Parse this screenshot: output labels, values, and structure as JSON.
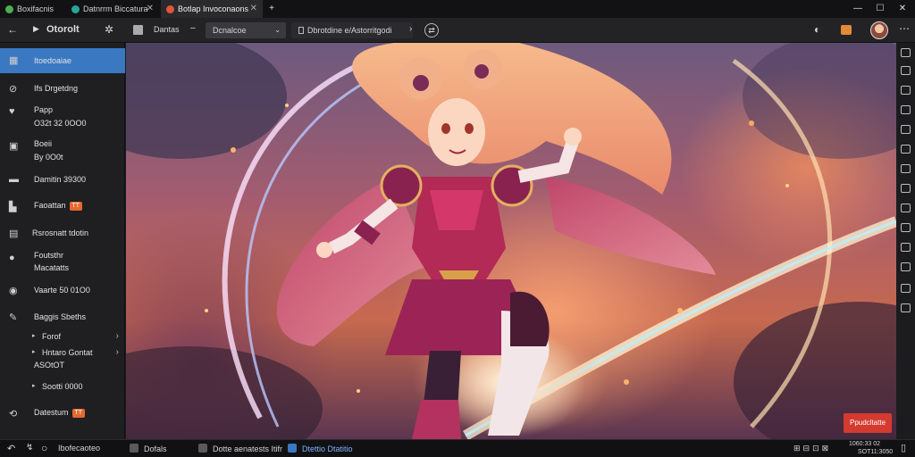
{
  "tabs": [
    {
      "label": "Boxifacnis",
      "color": "#4caf50",
      "active": false
    },
    {
      "label": "Datnrrm Biccatura",
      "color": "#26a69a",
      "active": false
    },
    {
      "label": "Botlap Invoconaons",
      "color": "#e2563a",
      "active": true
    }
  ],
  "window_controls": [
    "—",
    "☐",
    "✕"
  ],
  "toolbar": {
    "app_title": "Otorolt",
    "tab1_label": "Dantas",
    "dropdown_label": "Dcnalcoe",
    "path_label": "Dbrotdine e/Astorritgodi",
    "icons": [
      "back-arrow-icon",
      "play-icon",
      "settings-icon",
      "doc-icon",
      "chevron-right-icon",
      "share-icon",
      "mic-icon",
      "gift-icon",
      "avatar",
      "more-icon"
    ]
  },
  "sidebar": {
    "items": [
      {
        "label": "Itoedoaiae",
        "icon": "grid-icon",
        "active": true
      },
      {
        "label": "Ifs Drgetdng",
        "icon": "compass-icon"
      },
      {
        "label": "Papp",
        "icon": "heart-icon",
        "sub": "O32t 32 0OO0"
      },
      {
        "label": "Boeii",
        "icon": "calendar-icon",
        "sub": "By 0O0t"
      },
      {
        "label": "Damitin 39300",
        "icon": "chat-icon"
      },
      {
        "label": "Faoattan",
        "icon": "folder-icon",
        "badge": "TT"
      },
      {
        "label": "Rsrosnatt tdotin",
        "icon": "layout-icon"
      },
      {
        "label": "Foutsthr",
        "icon": "circle-icon",
        "sub": "Macatatts"
      },
      {
        "label": "Vaarte 50 01O0",
        "icon": "globe-icon"
      },
      {
        "label": "Baggis Sbeths",
        "icon": "pen-icon"
      },
      {
        "label": "Forof",
        "icon": "caret-icon",
        "chevron": true
      },
      {
        "label": "Hntaro Gontat",
        "icon": "caret-icon",
        "chevron": true,
        "sub": "ASOtOT"
      },
      {
        "label": "Sootti 0000",
        "icon": "caret-icon"
      },
      {
        "label": "Datestum",
        "icon": "sync-icon",
        "badge": "TT"
      }
    ]
  },
  "main": {
    "publish_label": "Ppudcltatte"
  },
  "taskbar": {
    "items": [
      "Ibofecaoteo",
      "Dofals",
      "Dotte aenatests Itifr",
      "Dtettio Dtatitio"
    ],
    "clock": "1060:33 02",
    "date": "SOT11:3050"
  },
  "colors": {
    "accent": "#3a78c2",
    "publish": "#d43a2f",
    "badge": "#e3692f"
  }
}
